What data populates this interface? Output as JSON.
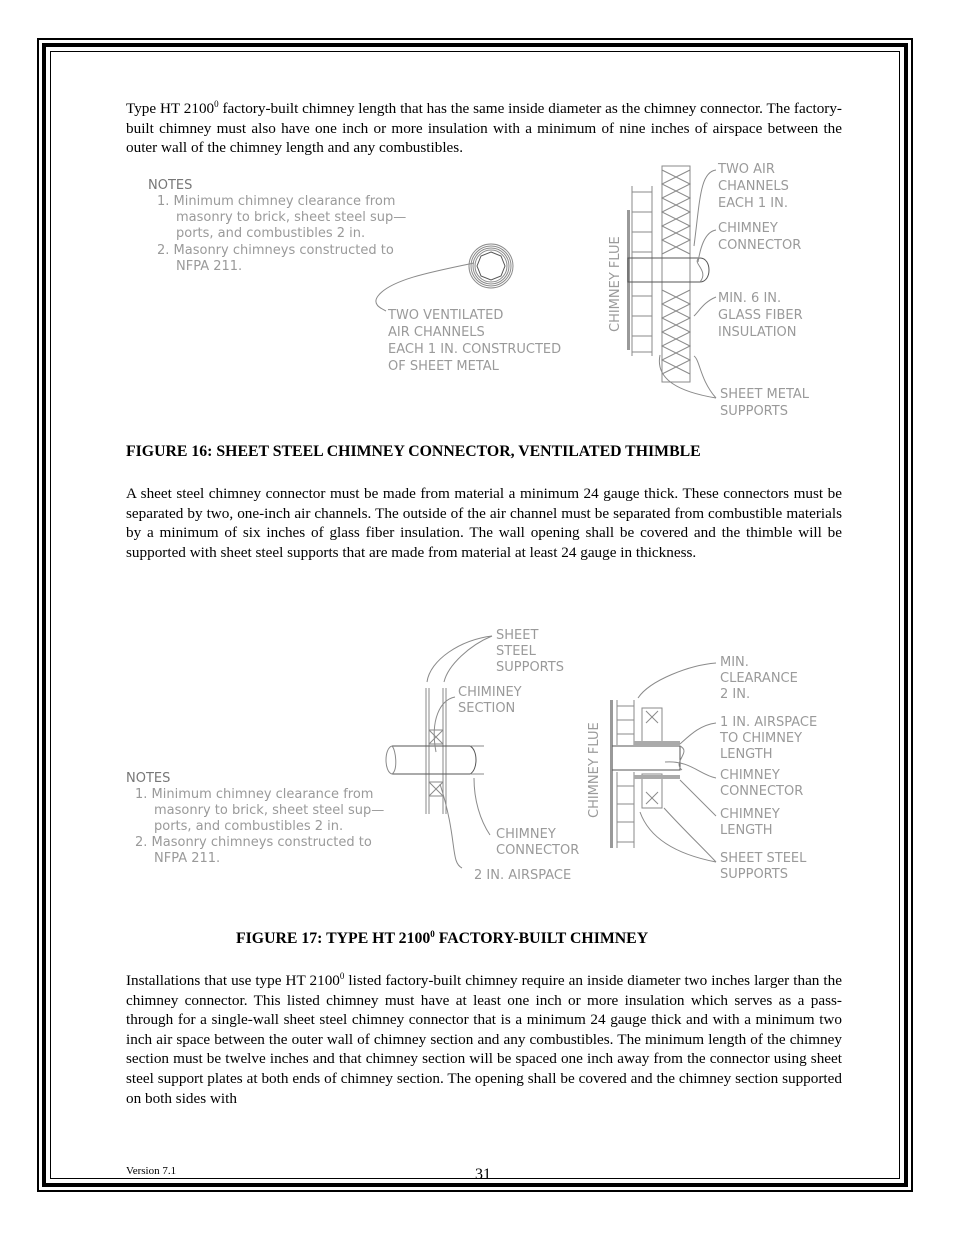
{
  "page": {
    "paragraph_1": {
      "pre": "Type HT 2100",
      "sup": "0",
      "post": " factory-built chimney length that has the same inside diameter as the chimney connector.  The factory-built chimney must also have one inch or more insulation with a minimum of nine inches of airspace between the outer wall of the chimney length and any combustibles."
    },
    "figure_16": {
      "notes_title": "NOTES",
      "notes": [
        "1. Minimum chimney clearance from",
        "masonry to brick, sheet steel sup—",
        "ports, and combustibles 2 in.",
        "2. Masonry chimneys constructed to",
        "NFPA 211."
      ],
      "ventilated_label": [
        "TWO VENTILATED",
        "AIR CHANNELS",
        "EACH 1 IN. CONSTRUCTED",
        "OF SHEET METAL"
      ],
      "flue_label": "CHIMNEY FLUE",
      "labels": {
        "air_channels": [
          "TWO AIR",
          "CHANNELS",
          "EACH 1 IN."
        ],
        "connector": [
          "CHIMNEY",
          "CONNECTOR"
        ],
        "insulation": [
          "MIN. 6 IN.",
          "GLASS FIBER",
          "INSULATION"
        ],
        "supports": [
          "SHEET METAL",
          "SUPPORTS"
        ]
      },
      "caption": "FIGURE 16: SHEET STEEL CHIMNEY CONNECTOR, VENTILATED THIMBLE"
    },
    "paragraph_2": "A sheet steel chimney connector must be made from material a minimum 24 gauge thick.  These connectors must be separated by two, one-inch air channels.  The outside of the air channel must be separated from combustible materials by a minimum of six inches of glass fiber insulation.  The wall opening shall be covered and the thimble will be supported with sheet steel supports that are made from material at least 24 gauge in thickness.",
    "figure_17": {
      "notes_title": "NOTES",
      "notes": [
        "1. Minimum chimney clearance from",
        "masonry to brick, sheet steel sup—",
        "ports, and combustibles 2 in.",
        "2. Masonry chimneys constructed to",
        "NFPA 211."
      ],
      "left_labels": {
        "supports": [
          "SHEET",
          "STEEL",
          "SUPPORTS"
        ],
        "section": [
          "CHIMINEY",
          "SECTION"
        ],
        "connector": [
          "CHIMNEY",
          "CONNECTOR"
        ],
        "airspace": "2 IN. AIRSPACE"
      },
      "flue_label": "CHIMNEY FLUE",
      "right_labels": {
        "clearance": [
          "MIN.",
          "CLEARANCE",
          "2 IN."
        ],
        "airspace": [
          "1 IN. AIRSPACE",
          "TO CHIMNEY",
          "LENGTH"
        ],
        "connector": [
          "CHIMNEY",
          "CONNECTOR"
        ],
        "length": [
          "CHIMNEY",
          "LENGTH"
        ],
        "supports": [
          "SHEET STEEL",
          "SUPPORTS"
        ]
      },
      "caption_pre": "FIGURE 17: TYPE HT 2100",
      "caption_sup": "0",
      "caption_post": " FACTORY-BUILT CHIMNEY"
    },
    "paragraph_3": {
      "pre": "Installations that use type HT 2100",
      "sup": "0",
      "post": " listed factory-built chimney require an inside diameter two inches larger than the chimney connector.  This listed chimney must have at least one inch or more insulation which serves as a pass-through for a single-wall sheet steel chimney connector that is a minimum 24 gauge thick and with a minimum two inch air space between the outer wall of chimney section and any combustibles.  The minimum length of the chimney section must be twelve inches and that chimney section will be spaced one inch away from the connector using sheet steel support plates at both ends of chimney section.  The opening shall be covered and the chimney section supported on both sides with"
    },
    "footer": {
      "version": "Version 7.1",
      "page_number": "31"
    }
  }
}
